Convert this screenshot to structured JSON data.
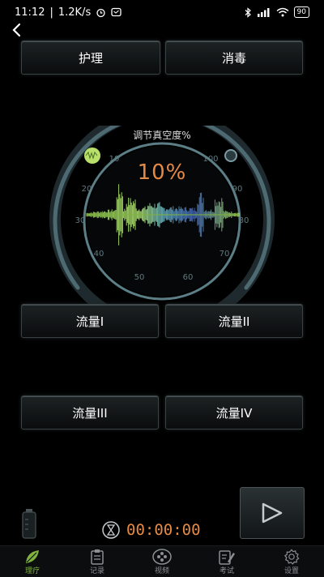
{
  "status": {
    "time": "11:12",
    "speed": "1.2K/s",
    "battery": "90"
  },
  "buttons": {
    "care": "护理",
    "disinfect": "消毒",
    "flow1": "流量I",
    "flow2": "流量II",
    "flow3": "流量III",
    "flow4": "流量IV"
  },
  "gauge": {
    "title": "调节真空度%",
    "value": "10%",
    "ticks": [
      "10",
      "20",
      "30",
      "40",
      "50",
      "60",
      "70",
      "80",
      "90",
      "100"
    ]
  },
  "timer": {
    "display": "00:00:00"
  },
  "tabs": [
    {
      "label": "理疗",
      "icon": "leaf-icon"
    },
    {
      "label": "记录",
      "icon": "clipboard-icon"
    },
    {
      "label": "视频",
      "icon": "film-reel-icon"
    },
    {
      "label": "考试",
      "icon": "edit-paper-icon"
    },
    {
      "label": "设置",
      "icon": "gear-icon"
    }
  ],
  "colors": {
    "accent": "#e58a45",
    "active_tab": "#7fb33d",
    "gauge_ring": "#5c7e86"
  }
}
